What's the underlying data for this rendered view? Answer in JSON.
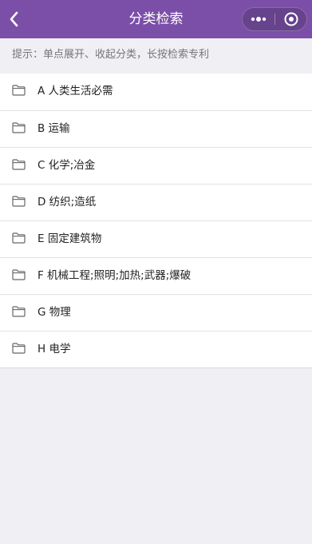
{
  "header": {
    "title": "分类检索",
    "background_color": "#7b4fa8",
    "back_icon": "chevron-left-icon",
    "more_icon": "more-dots-icon",
    "close_icon": "target-circle-icon"
  },
  "hint": {
    "text": "提示：单点展开、收起分类，长按检索专利"
  },
  "categories": [
    {
      "label": "A 人类生活必需",
      "icon": "folder-icon"
    },
    {
      "label": "B 运输",
      "icon": "folder-icon"
    },
    {
      "label": "C 化学;冶金",
      "icon": "folder-icon"
    },
    {
      "label": "D 纺织;造纸",
      "icon": "folder-icon"
    },
    {
      "label": "E 固定建筑物",
      "icon": "folder-icon"
    },
    {
      "label": "F 机械工程;照明;加热;武器;爆破",
      "icon": "folder-icon"
    },
    {
      "label": "G 物理",
      "icon": "folder-icon"
    },
    {
      "label": "H 电学",
      "icon": "folder-icon"
    }
  ]
}
